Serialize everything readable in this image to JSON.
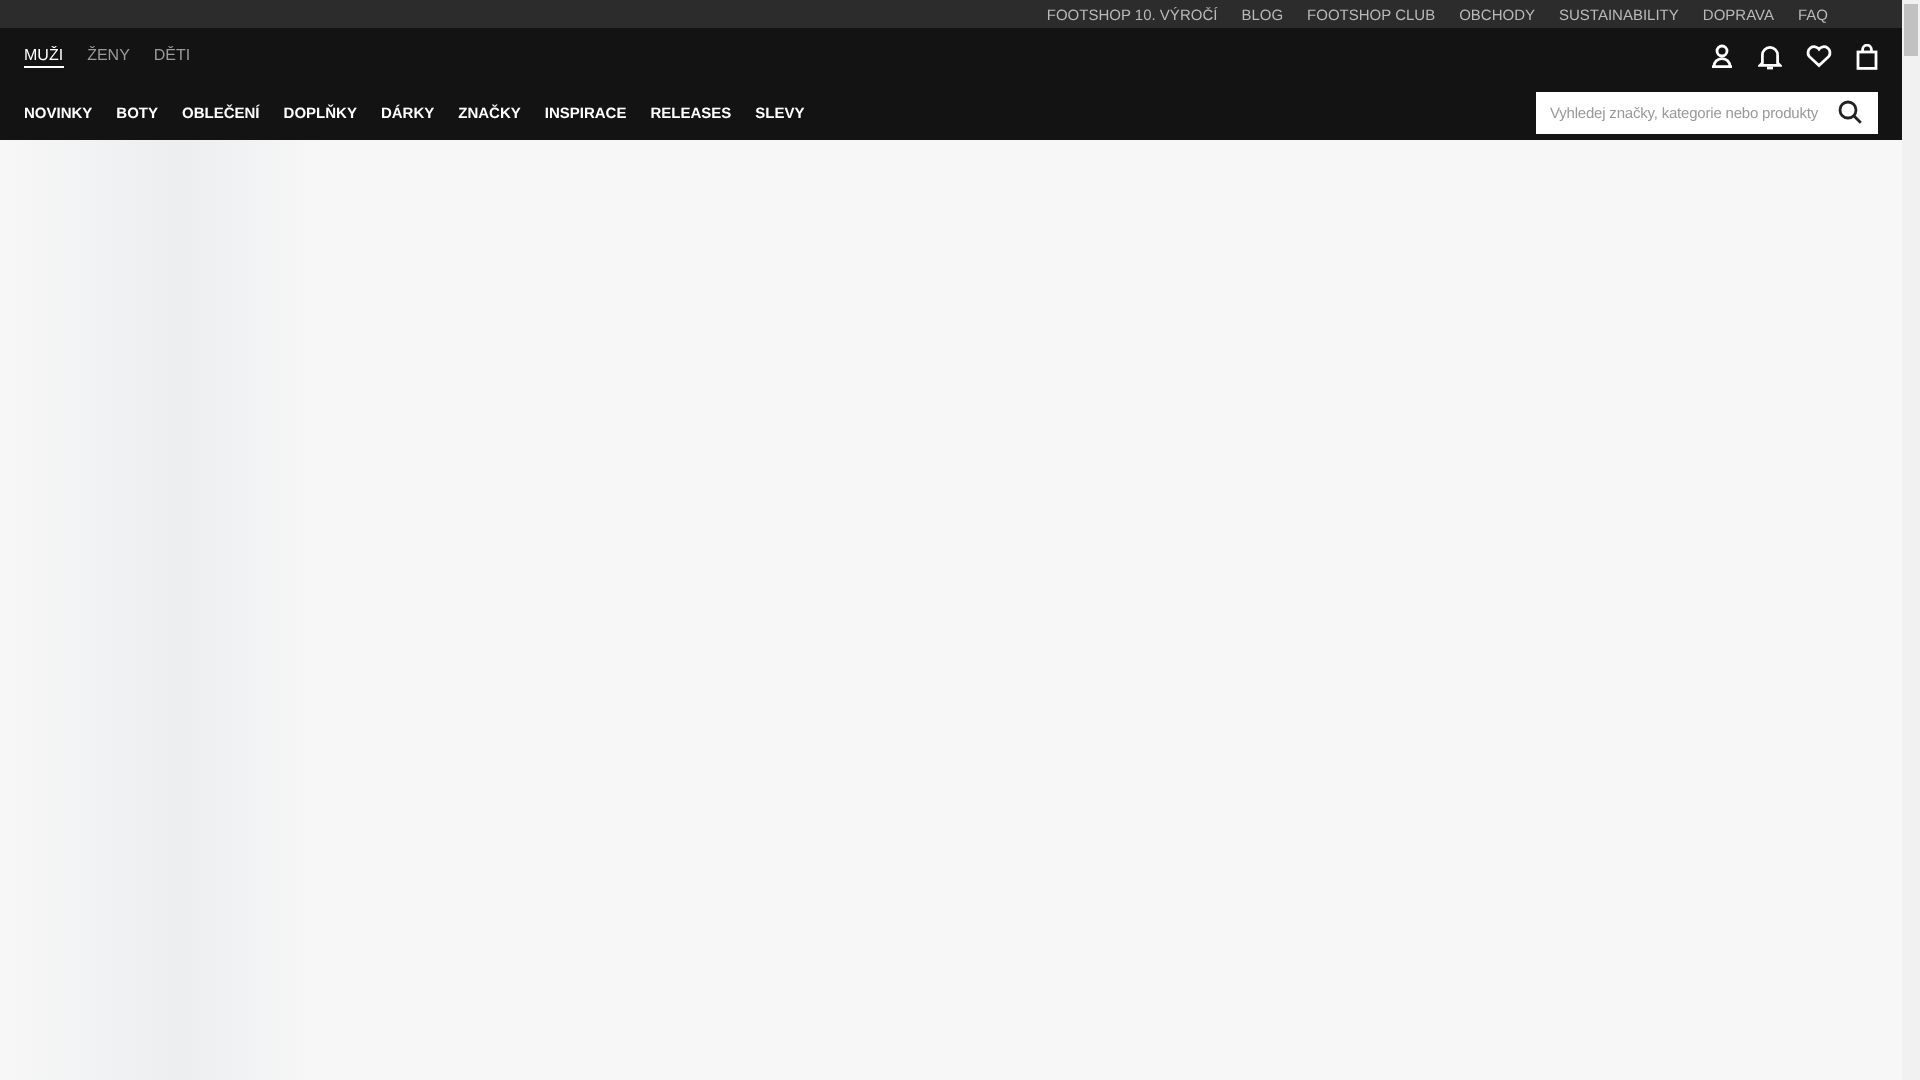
{
  "top_links": [
    "FOOTSHOP 10. VÝROČÍ",
    "BLOG",
    "FOOTSHOP CLUB",
    "OBCHODY",
    "SUSTAINABILITY",
    "DOPRAVA",
    "FAQ"
  ],
  "gender_tabs": [
    {
      "label": "MUŽI",
      "selected": true
    },
    {
      "label": "ŽENY",
      "selected": false
    },
    {
      "label": "DĚTI",
      "selected": false
    }
  ],
  "categories": [
    "NOVINKY",
    "BOTY",
    "OBLEČENÍ",
    "DOPLŇKY",
    "DÁRKY",
    "ZNAČKY",
    "INSPIRACE",
    "RELEASES",
    "SLEVY"
  ],
  "search": {
    "placeholder": "Vyhledej značky, kategorie nebo produkty"
  }
}
